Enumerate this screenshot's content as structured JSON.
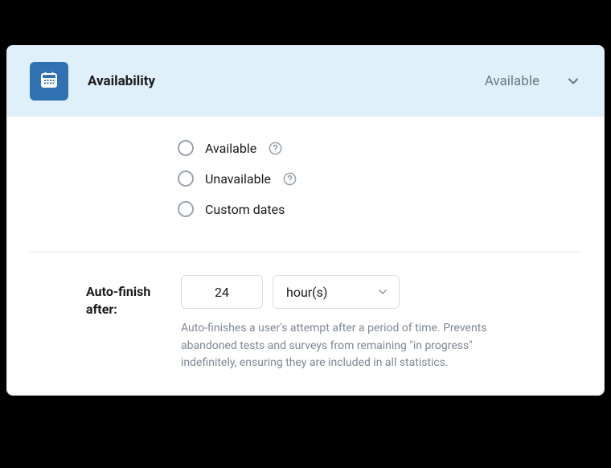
{
  "header": {
    "title": "Availability",
    "status": "Available"
  },
  "options": [
    {
      "label": "Available",
      "has_help": true
    },
    {
      "label": "Unavailable",
      "has_help": true
    },
    {
      "label": "Custom dates",
      "has_help": false
    }
  ],
  "auto_finish": {
    "label": "Auto-finish after:",
    "value": "24",
    "unit": "hour(s)",
    "help": "Auto-finishes a user's attempt after a period of time. Prevents abandoned tests and surveys from remaining \"in progress\" indefinitely, ensuring they are included in all statistics."
  }
}
